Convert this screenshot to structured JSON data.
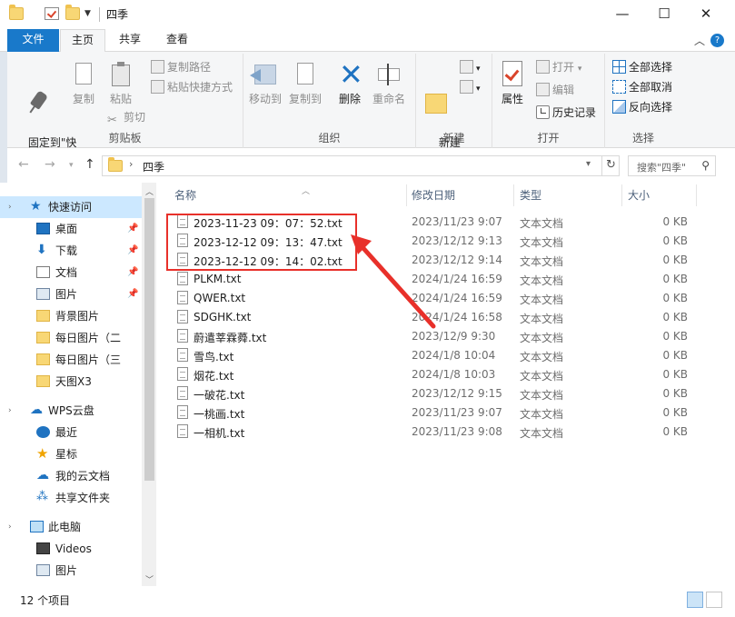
{
  "window": {
    "title": "四季",
    "minimize": "—",
    "maximize": "☐",
    "close": "✕"
  },
  "ribbon_tabs": {
    "file": "文件",
    "home": "主页",
    "share": "共享",
    "view": "查看"
  },
  "ribbon": {
    "clipboard": {
      "label": "剪贴板",
      "pin": "固定到\"快\n速访问\"",
      "copy": "复制",
      "paste": "粘贴",
      "copy_path": "复制路径",
      "paste_shortcut": "粘贴快捷方式",
      "cut": "剪切"
    },
    "organize": {
      "label": "组织",
      "move_to": "移动到",
      "copy_to": "复制到",
      "delete": "删除",
      "rename": "重命名"
    },
    "new": {
      "label": "新建",
      "new_folder": "新建\n文件夹"
    },
    "open": {
      "label": "打开",
      "properties": "属性",
      "open": "打开",
      "edit": "编辑",
      "history": "历史记录"
    },
    "select": {
      "label": "选择",
      "select_all": "全部选择",
      "select_none": "全部取消",
      "invert": "反向选择"
    }
  },
  "address": {
    "path": "四季",
    "separator": "›",
    "search_placeholder": "搜索\"四季\""
  },
  "nav_pane": {
    "quick_access": "快速访问",
    "items": [
      {
        "label": "桌面",
        "pinned": true
      },
      {
        "label": "下载",
        "pinned": true
      },
      {
        "label": "文档",
        "pinned": true
      },
      {
        "label": "图片",
        "pinned": true
      },
      {
        "label": "背景图片",
        "pinned": false
      },
      {
        "label": "每日图片（二",
        "pinned": false
      },
      {
        "label": "每日图片（三",
        "pinned": false
      },
      {
        "label": "天图X3",
        "pinned": false
      }
    ],
    "wps": "WPS云盘",
    "wps_items": [
      "最近",
      "星标",
      "我的云文档",
      "共享文件夹"
    ],
    "this_pc": "此电脑",
    "pc_items": [
      "Videos",
      "图片"
    ]
  },
  "file_list": {
    "columns": {
      "name": "名称",
      "date": "修改日期",
      "type": "类型",
      "size": "大小"
    },
    "rows": [
      {
        "name": "2023-11-23 09：07：52.txt",
        "date": "2023/11/23 9:07",
        "type": "文本文档",
        "size": "0 KB"
      },
      {
        "name": "2023-12-12 09：13：47.txt",
        "date": "2023/12/12 9:13",
        "type": "文本文档",
        "size": "0 KB"
      },
      {
        "name": "2023-12-12 09：14：02.txt",
        "date": "2023/12/12 9:14",
        "type": "文本文档",
        "size": "0 KB"
      },
      {
        "name": "PLKM.txt",
        "date": "2024/1/24 16:59",
        "type": "文本文档",
        "size": "0 KB"
      },
      {
        "name": "QWER.txt",
        "date": "2024/1/24 16:59",
        "type": "文本文档",
        "size": "0 KB"
      },
      {
        "name": "SDGHK.txt",
        "date": "2024/1/24 16:58",
        "type": "文本文档",
        "size": "0 KB"
      },
      {
        "name": "蔚遣莘霖蕣.txt",
        "date": "2023/12/9 9:30",
        "type": "文本文档",
        "size": "0 KB"
      },
      {
        "name": "雪鸟.txt",
        "date": "2024/1/8 10:04",
        "type": "文本文档",
        "size": "0 KB"
      },
      {
        "name": "烟花.txt",
        "date": "2024/1/8 10:03",
        "type": "文本文档",
        "size": "0 KB"
      },
      {
        "name": "一破花.txt",
        "date": "2023/12/12 9:15",
        "type": "文本文档",
        "size": "0 KB"
      },
      {
        "name": "一桃画.txt",
        "date": "2023/11/23 9:07",
        "type": "文本文档",
        "size": "0 KB"
      },
      {
        "name": "一相机.txt",
        "date": "2023/11/23 9:08",
        "type": "文本文档",
        "size": "0 KB"
      }
    ]
  },
  "status": {
    "count": "12 个项目"
  },
  "colors": {
    "accent": "#1979ca",
    "selection": "#cce8ff",
    "annotation": "#e8302a"
  }
}
